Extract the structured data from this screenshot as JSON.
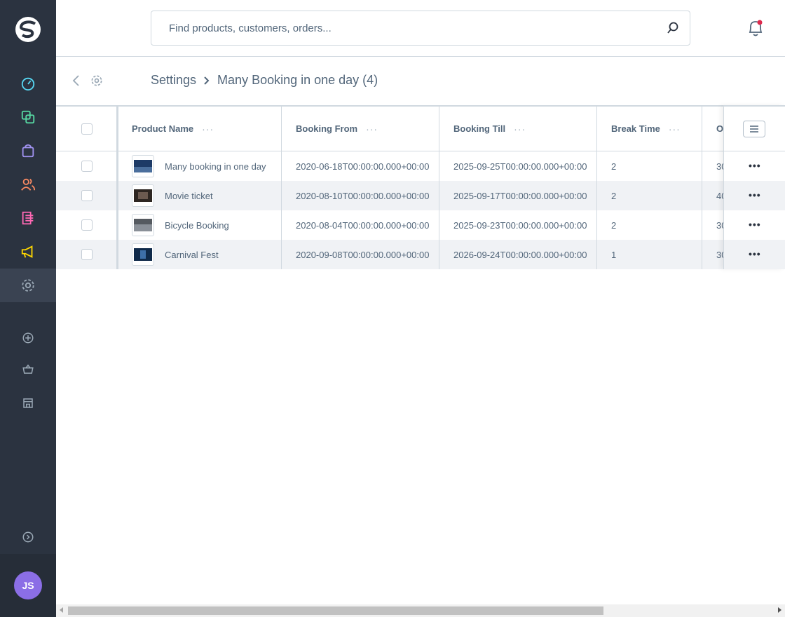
{
  "search": {
    "placeholder": "Find products, customers, orders..."
  },
  "breadcrumb": {
    "parent": "Settings",
    "current": "Many Booking in one day (4)"
  },
  "sidebar": {
    "avatar_initials": "JS",
    "items": [
      {
        "icon": "dashboard-icon",
        "color": "#57d9f4"
      },
      {
        "icon": "catalog-icon",
        "color": "#57d9a3"
      },
      {
        "icon": "orders-icon",
        "color": "#a092f0"
      },
      {
        "icon": "customers-icon",
        "color": "#f88962"
      },
      {
        "icon": "content-icon",
        "color": "#ff68b4"
      },
      {
        "icon": "marketing-icon",
        "color": "#ffd700"
      },
      {
        "icon": "settings-icon",
        "color": "#9aa8b5"
      }
    ]
  },
  "grid": {
    "columns": [
      "Product Name",
      "Booking From",
      "Booking Till",
      "Break Time",
      "O"
    ],
    "rows": [
      {
        "name": "Many booking in one day",
        "from": "2020-06-18T00:00:00.000+00:00",
        "till": "2025-09-25T00:00:00.000+00:00",
        "break": "2",
        "o": "30"
      },
      {
        "name": "Movie ticket",
        "from": "2020-08-10T00:00:00.000+00:00",
        "till": "2025-09-17T00:00:00.000+00:00",
        "break": "2",
        "o": "40"
      },
      {
        "name": "Bicycle Booking",
        "from": "2020-08-04T00:00:00.000+00:00",
        "till": "2025-09-23T00:00:00.000+00:00",
        "break": "2",
        "o": "30"
      },
      {
        "name": "Carnival Fest",
        "from": "2020-09-08T00:00:00.000+00:00",
        "till": "2026-09-24T00:00:00.000+00:00",
        "break": "1",
        "o": "30"
      }
    ]
  },
  "colors": {
    "sidebar": "#2b3340",
    "avatar": "#8b6ee6",
    "notification_dot": "#de294c"
  }
}
